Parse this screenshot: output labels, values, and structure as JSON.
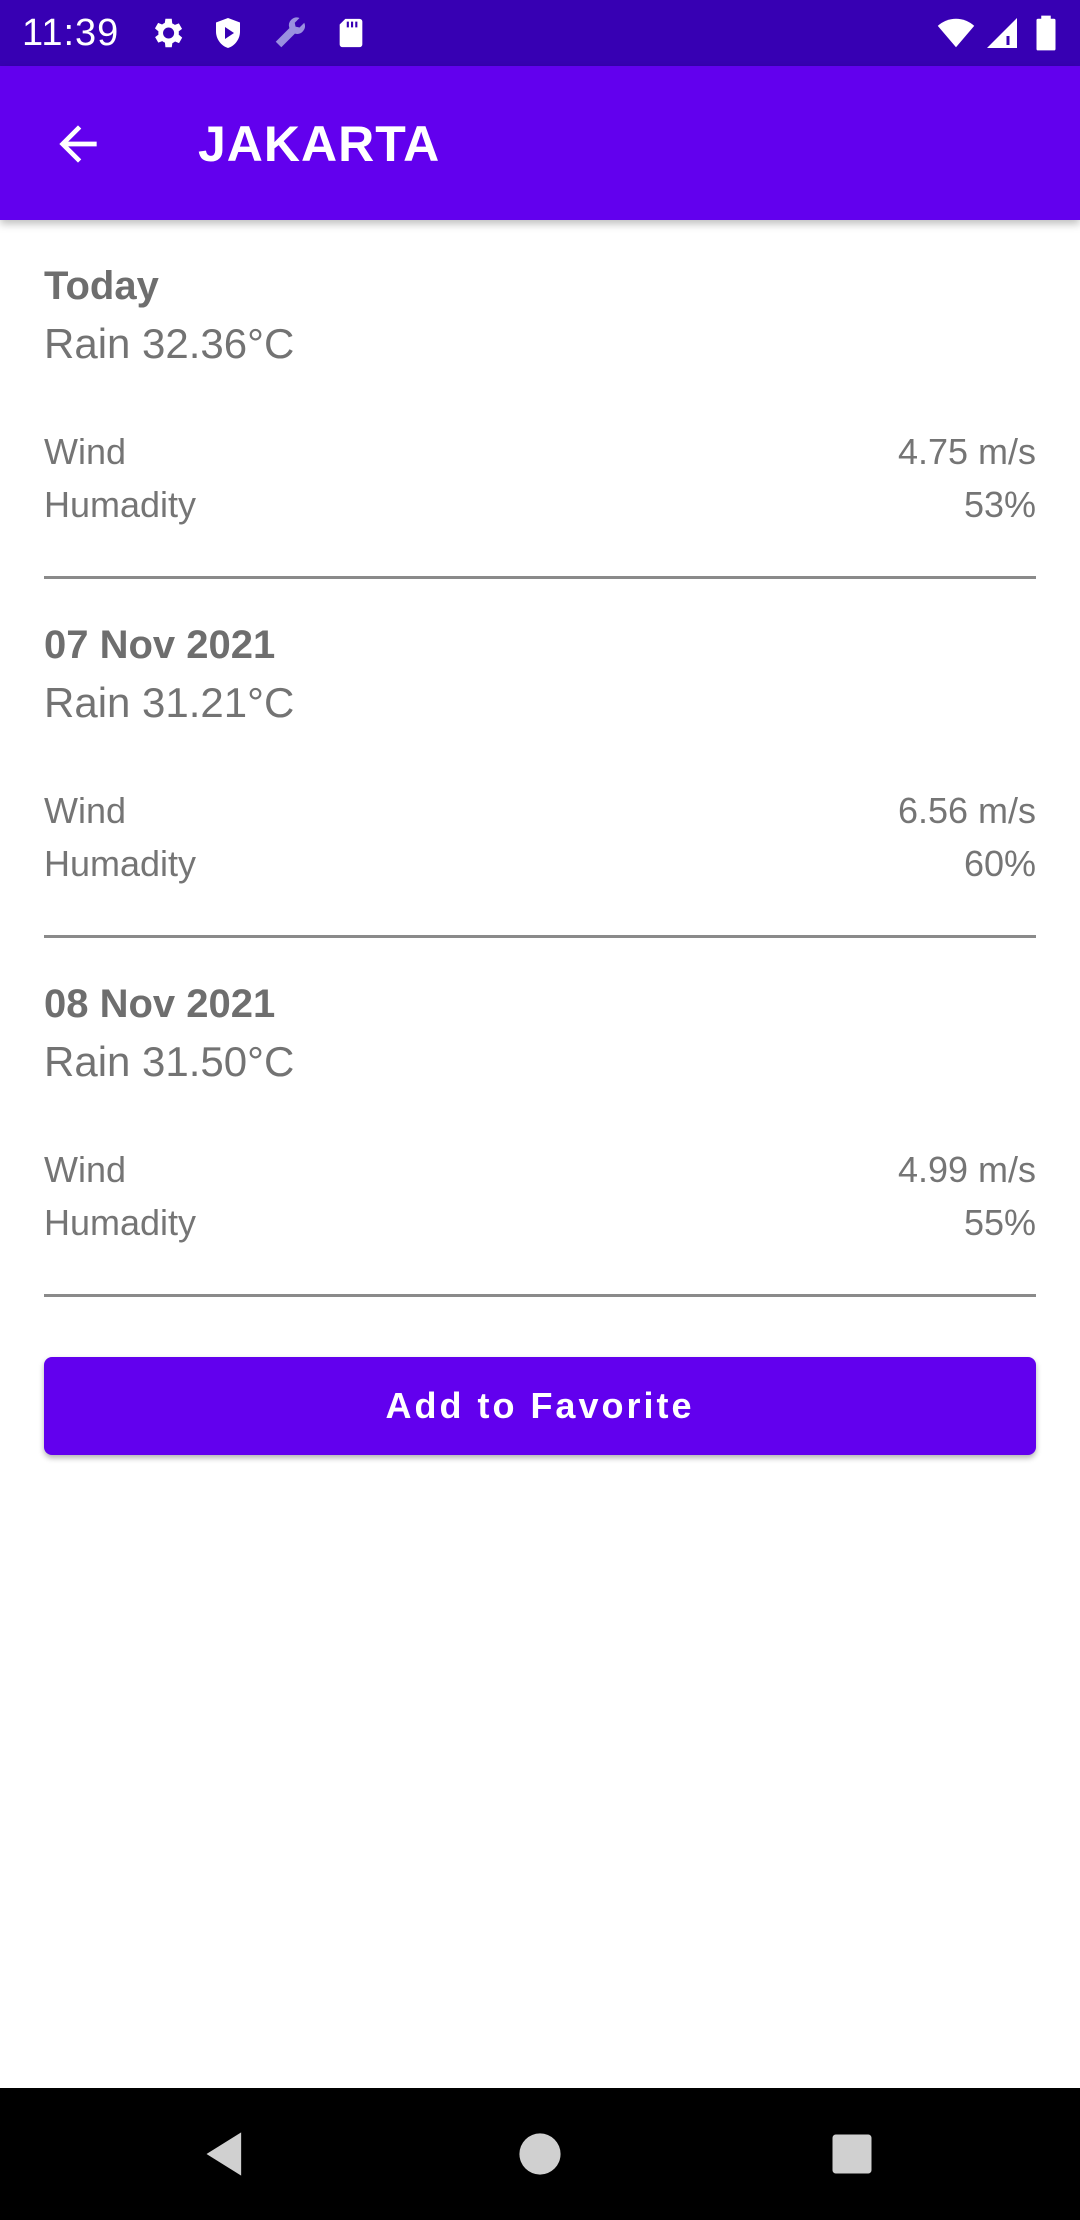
{
  "status_bar": {
    "time": "11:39",
    "icons": [
      "settings-icon",
      "shield-icon",
      "wrench-icon",
      "sd-card-icon",
      "wifi-icon",
      "signal-icon",
      "battery-icon"
    ]
  },
  "app_bar": {
    "title": "JAKARTA",
    "back_icon": "arrow-back-icon",
    "color": "#6200ee"
  },
  "forecast": [
    {
      "date": "Today",
      "condition": "Rain 32.36°C",
      "wind_label": "Wind",
      "wind_value": "4.75 m/s",
      "humidity_label": "Humadity",
      "humidity_value": "53%"
    },
    {
      "date": "07 Nov 2021",
      "condition": "Rain 31.21°C",
      "wind_label": "Wind",
      "wind_value": "6.56 m/s",
      "humidity_label": "Humadity",
      "humidity_value": "60%"
    },
    {
      "date": "08 Nov 2021",
      "condition": "Rain 31.50°C",
      "wind_label": "Wind",
      "wind_value": "4.99 m/s",
      "humidity_label": "Humadity",
      "humidity_value": "55%"
    }
  ],
  "favorite_button": {
    "label": "Add to Favorite"
  },
  "nav_bar": {
    "icons": [
      "back-triangle-icon",
      "home-circle-icon",
      "recents-square-icon"
    ]
  }
}
